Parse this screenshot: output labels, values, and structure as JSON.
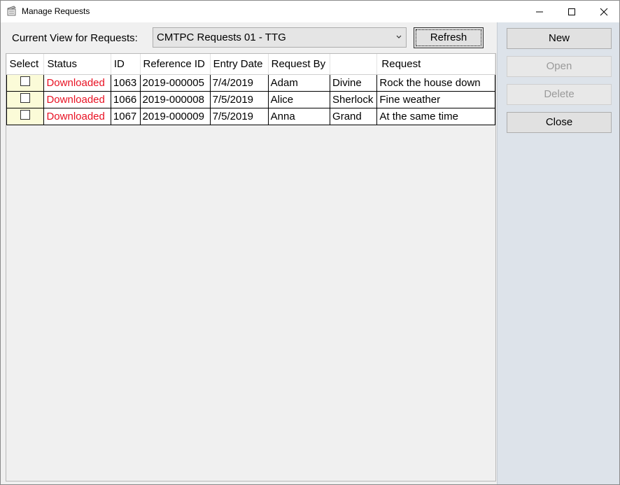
{
  "window": {
    "title": "Manage Requests"
  },
  "toolbar": {
    "view_label": "Current View for Requests:",
    "view_value": "CMTPC Requests 01 - TTG",
    "refresh_label": "Refresh"
  },
  "grid": {
    "headers": [
      "Select",
      "Status",
      "ID",
      "Reference ID",
      "Entry Date",
      "Request By",
      "",
      "Request"
    ],
    "rows": [
      {
        "selected": false,
        "status": "Downloaded",
        "id": "1063",
        "reference_id": "2019-000005",
        "entry_date": "7/4/2019",
        "request_by": "Adam",
        "last_name": "Divine",
        "request": "Rock the house down"
      },
      {
        "selected": false,
        "status": "Downloaded",
        "id": "1066",
        "reference_id": "2019-000008",
        "entry_date": "7/5/2019",
        "request_by": "Alice",
        "last_name": "Sherlock",
        "request": "Fine weather"
      },
      {
        "selected": false,
        "status": "Downloaded",
        "id": "1067",
        "reference_id": "2019-000009",
        "entry_date": "7/5/2019",
        "request_by": "Anna",
        "last_name": "Grand",
        "request": "At the same time"
      }
    ]
  },
  "actions": {
    "new_label": "New",
    "open_label": "Open",
    "delete_label": "Delete",
    "close_label": "Close"
  },
  "colors": {
    "status_downloaded": "#e81123",
    "side_panel": "#dde3ea",
    "select_cell": "#fbfbd8"
  }
}
